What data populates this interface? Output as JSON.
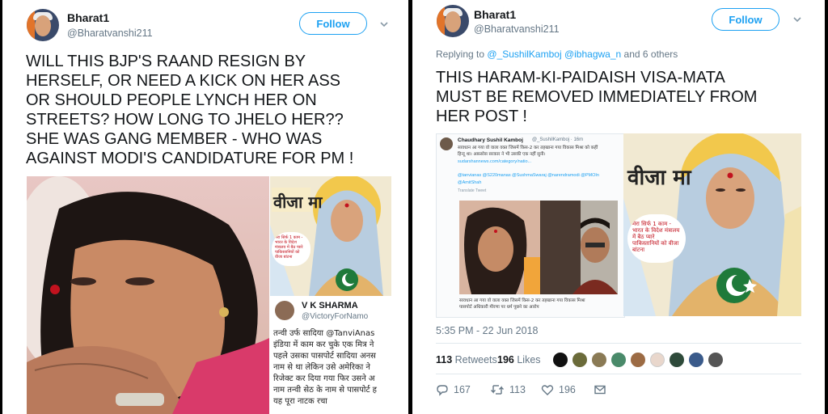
{
  "left_tweet": {
    "name": "Bharat1",
    "handle": "@Bharatvanshi211",
    "follow_label": "Follow",
    "text_lines": [
      "WILL THIS BJP'S RAAND RESIGN BY",
      "HERSELF, OR NEED A KICK ON HER ASS",
      "OR SHOULD PEOPLE LYNCH HER ON",
      "STREETS? HOW LONG TO JHELO HER??",
      "SHE WAS GANG MEMBER - WHO WAS",
      "AGAINST MODI'S CANDIDATURE FOR PM !"
    ],
    "poster_title": "वीजा मा",
    "poster_bubble": "मेरा सिर्फ 1 काम - भारत के विदेश मंत्रालय में बैठ प्यारे पाकिस्तानियों को वीजा बांटना",
    "embedded": {
      "name": "V K SHARMA",
      "handle": "@VictoryForNamo",
      "lines": [
        "तन्वी उर्फ सादिया @TanviAnas",
        "इंडिया में काम कर चुके एक मित्र ने",
        "पहले उसका पासपोर्ट सादिया अनस",
        "नाम से था लेकिन उसे अमेरिका ने",
        "रिजेक्ट कर दिया गया फिर उसने अ",
        "नाम तन्वी सेठ के नाम से पासपोर्ट ह",
        "यह पूरा नाटक रचा"
      ]
    }
  },
  "right_tweet": {
    "name": "Bharat1",
    "handle": "@Bharatvanshi211",
    "follow_label": "Follow",
    "replying_prefix": "Replying to",
    "replying_users": "@_SushilKamboj @ibhagwa_n",
    "replying_suffix": "and 6 others",
    "text_lines": [
      "THIS HARAM-KI-PAIDAISH VISA-MATA",
      "MUST BE REMOVED IMMEDIATELY FROM",
      "HER POST !"
    ],
    "quoted": {
      "name": "Chaudhary Sushil Kamboj",
      "handle": "@_SushilKamboj · 16m",
      "line1": "सावधान आ गया वो वाला वक्त जिसमें किस-2 कर तहखाना गया विकास मिश्रा को कहीं",
      "line2": "हिन्दू था। अफ़सोस सरकार ने भी उसकी एक नहीं सुनी।",
      "link": "sudarshannews.com/category/natio...",
      "mentions": "@tanvianas @S220manas @SushmaSwaraj @narendramodi @PMOIn",
      "mention2": "@AmitShah",
      "translate": "Translate Tweet",
      "caption1": "सावधान आ गया वो वाला वक्त जिसमें किस-2 कर तहखाना गया विकास मिश्रा",
      "caption2": "पासपोर्ट अधिकारी मीरणा पर धर्म पूछने का आरोप"
    },
    "poster_title": "वीजा  मा",
    "poster_bubble": "मेरा सिर्फ 1 काम - भारत के विदेश मंत्रालय में बैठ प्यारे पाकिस्तानियों को वीजा बांटना",
    "timestamp": "5:35 PM - 22 Jun 2018",
    "retweets_count": "113",
    "retweets_label": "Retweets",
    "likes_count": "196",
    "likes_label": "Likes",
    "actions": {
      "replies": "167",
      "retweets": "113",
      "likes": "196"
    }
  }
}
